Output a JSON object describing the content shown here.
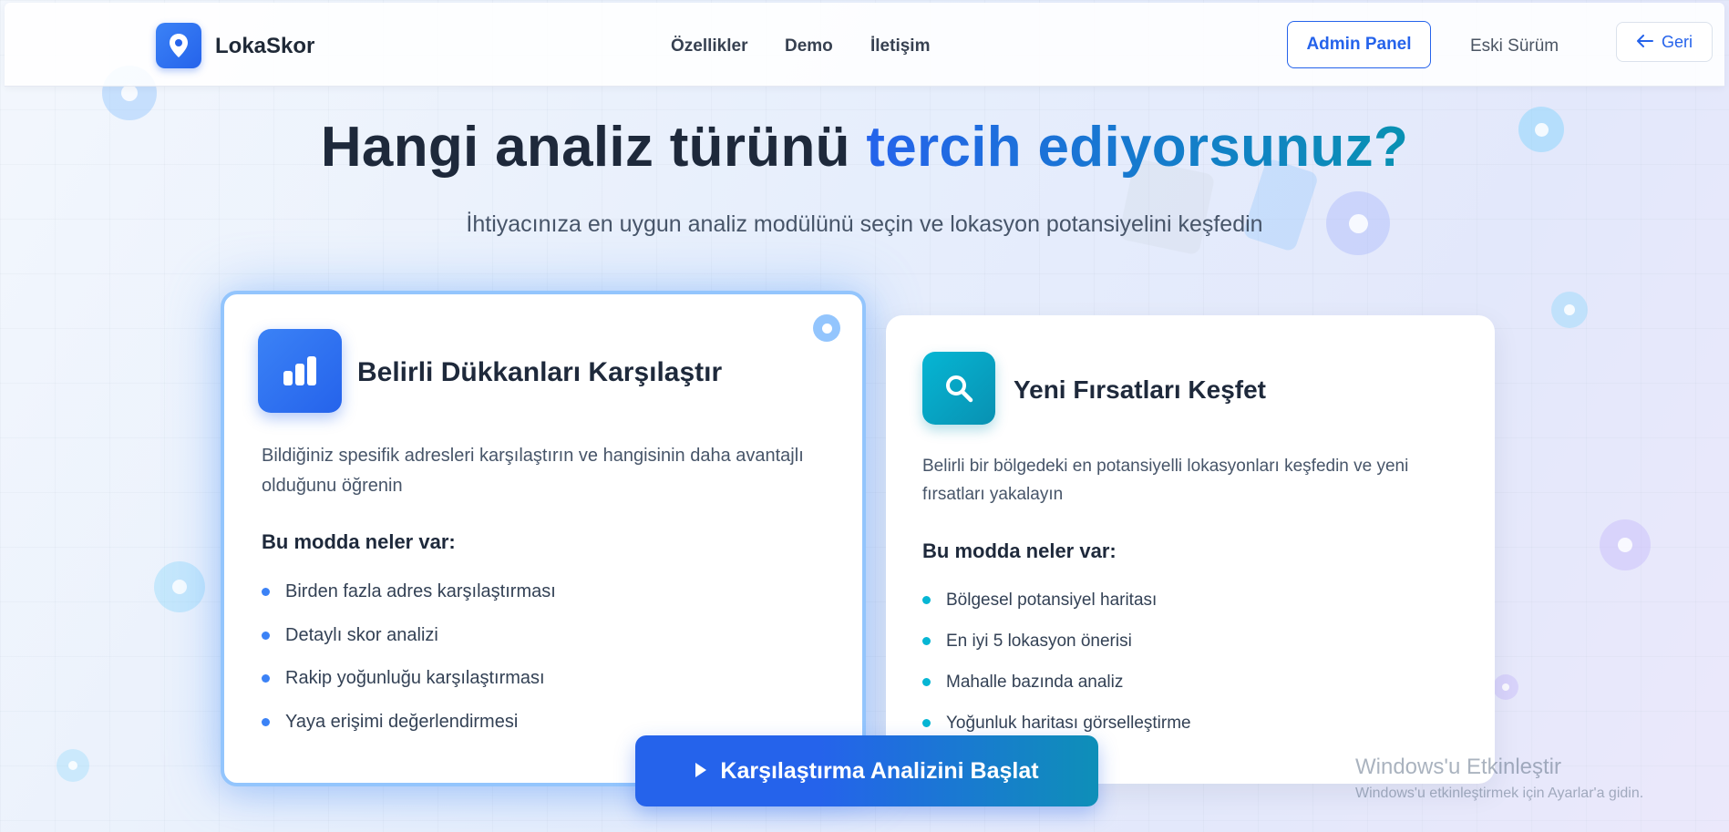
{
  "header": {
    "logo_text": "LokaSkor",
    "nav": [
      "Özellikler",
      "Demo",
      "İletişim"
    ],
    "admin_label": "Admin Panel",
    "old_version_label": "Eski Sürüm",
    "back_label": "Geri"
  },
  "hero": {
    "title_part1": "Hangi analiz türünü",
    "title_part2": "tercih ediyorsunuz?",
    "subtitle": "İhtiyacınıza en uygun analiz modülünü seçin ve lokasyon potansiyelini keşfedin"
  },
  "cards": [
    {
      "title": "Belirli Dükkanları Karşılaştır",
      "description": "Bildiğiniz spesifik adresleri karşılaştırın ve hangisinin daha avantajlı olduğunu öğrenin",
      "features_heading": "Bu modda neler var:",
      "features": [
        "Birden fazla adres karşılaştırması",
        "Detaylı skor analizi",
        "Rakip yoğunluğu karşılaştırması",
        "Yaya erişimi değerlendirmesi"
      ],
      "icon": "chart-bars-icon",
      "selected": true
    },
    {
      "title": "Yeni Fırsatları Keşfet",
      "description": "Belirli bir bölgedeki en potansiyelli lokasyonları keşfedin ve yeni fırsatları yakalayın",
      "features_heading": "Bu modda neler var:",
      "features": [
        "Bölgesel potansiyel haritası",
        "En iyi 5 lokasyon önerisi",
        "Mahalle bazında analiz",
        "Yoğunluk haritası görselleştirme"
      ],
      "icon": "search-icon",
      "selected": false
    }
  ],
  "cta": {
    "label": "Karşılaştırma Analizini Başlat",
    "icon": "play-icon"
  },
  "watermark": {
    "line1": "Windows'u Etkinleştir",
    "line2": "Windows'u etkinleştirmek için Ayarlar'a gidin."
  },
  "colors": {
    "primary": "#2563eb",
    "teal": "#0891b2",
    "text_dark": "#1e293b",
    "text_muted": "#475569"
  }
}
